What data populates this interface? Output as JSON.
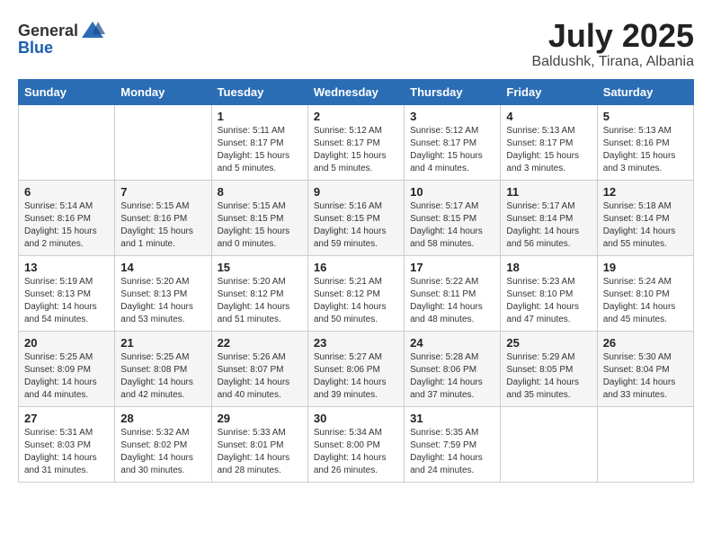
{
  "logo": {
    "text_general": "General",
    "text_blue": "Blue"
  },
  "title": {
    "month_year": "July 2025",
    "location": "Baldushk, Tirana, Albania"
  },
  "headers": [
    "Sunday",
    "Monday",
    "Tuesday",
    "Wednesday",
    "Thursday",
    "Friday",
    "Saturday"
  ],
  "weeks": [
    [
      {
        "day": "",
        "sunrise": "",
        "sunset": "",
        "daylight": ""
      },
      {
        "day": "",
        "sunrise": "",
        "sunset": "",
        "daylight": ""
      },
      {
        "day": "1",
        "sunrise": "Sunrise: 5:11 AM",
        "sunset": "Sunset: 8:17 PM",
        "daylight": "Daylight: 15 hours and 5 minutes."
      },
      {
        "day": "2",
        "sunrise": "Sunrise: 5:12 AM",
        "sunset": "Sunset: 8:17 PM",
        "daylight": "Daylight: 15 hours and 5 minutes."
      },
      {
        "day": "3",
        "sunrise": "Sunrise: 5:12 AM",
        "sunset": "Sunset: 8:17 PM",
        "daylight": "Daylight: 15 hours and 4 minutes."
      },
      {
        "day": "4",
        "sunrise": "Sunrise: 5:13 AM",
        "sunset": "Sunset: 8:17 PM",
        "daylight": "Daylight: 15 hours and 3 minutes."
      },
      {
        "day": "5",
        "sunrise": "Sunrise: 5:13 AM",
        "sunset": "Sunset: 8:16 PM",
        "daylight": "Daylight: 15 hours and 3 minutes."
      }
    ],
    [
      {
        "day": "6",
        "sunrise": "Sunrise: 5:14 AM",
        "sunset": "Sunset: 8:16 PM",
        "daylight": "Daylight: 15 hours and 2 minutes."
      },
      {
        "day": "7",
        "sunrise": "Sunrise: 5:15 AM",
        "sunset": "Sunset: 8:16 PM",
        "daylight": "Daylight: 15 hours and 1 minute."
      },
      {
        "day": "8",
        "sunrise": "Sunrise: 5:15 AM",
        "sunset": "Sunset: 8:15 PM",
        "daylight": "Daylight: 15 hours and 0 minutes."
      },
      {
        "day": "9",
        "sunrise": "Sunrise: 5:16 AM",
        "sunset": "Sunset: 8:15 PM",
        "daylight": "Daylight: 14 hours and 59 minutes."
      },
      {
        "day": "10",
        "sunrise": "Sunrise: 5:17 AM",
        "sunset": "Sunset: 8:15 PM",
        "daylight": "Daylight: 14 hours and 58 minutes."
      },
      {
        "day": "11",
        "sunrise": "Sunrise: 5:17 AM",
        "sunset": "Sunset: 8:14 PM",
        "daylight": "Daylight: 14 hours and 56 minutes."
      },
      {
        "day": "12",
        "sunrise": "Sunrise: 5:18 AM",
        "sunset": "Sunset: 8:14 PM",
        "daylight": "Daylight: 14 hours and 55 minutes."
      }
    ],
    [
      {
        "day": "13",
        "sunrise": "Sunrise: 5:19 AM",
        "sunset": "Sunset: 8:13 PM",
        "daylight": "Daylight: 14 hours and 54 minutes."
      },
      {
        "day": "14",
        "sunrise": "Sunrise: 5:20 AM",
        "sunset": "Sunset: 8:13 PM",
        "daylight": "Daylight: 14 hours and 53 minutes."
      },
      {
        "day": "15",
        "sunrise": "Sunrise: 5:20 AM",
        "sunset": "Sunset: 8:12 PM",
        "daylight": "Daylight: 14 hours and 51 minutes."
      },
      {
        "day": "16",
        "sunrise": "Sunrise: 5:21 AM",
        "sunset": "Sunset: 8:12 PM",
        "daylight": "Daylight: 14 hours and 50 minutes."
      },
      {
        "day": "17",
        "sunrise": "Sunrise: 5:22 AM",
        "sunset": "Sunset: 8:11 PM",
        "daylight": "Daylight: 14 hours and 48 minutes."
      },
      {
        "day": "18",
        "sunrise": "Sunrise: 5:23 AM",
        "sunset": "Sunset: 8:10 PM",
        "daylight": "Daylight: 14 hours and 47 minutes."
      },
      {
        "day": "19",
        "sunrise": "Sunrise: 5:24 AM",
        "sunset": "Sunset: 8:10 PM",
        "daylight": "Daylight: 14 hours and 45 minutes."
      }
    ],
    [
      {
        "day": "20",
        "sunrise": "Sunrise: 5:25 AM",
        "sunset": "Sunset: 8:09 PM",
        "daylight": "Daylight: 14 hours and 44 minutes."
      },
      {
        "day": "21",
        "sunrise": "Sunrise: 5:25 AM",
        "sunset": "Sunset: 8:08 PM",
        "daylight": "Daylight: 14 hours and 42 minutes."
      },
      {
        "day": "22",
        "sunrise": "Sunrise: 5:26 AM",
        "sunset": "Sunset: 8:07 PM",
        "daylight": "Daylight: 14 hours and 40 minutes."
      },
      {
        "day": "23",
        "sunrise": "Sunrise: 5:27 AM",
        "sunset": "Sunset: 8:06 PM",
        "daylight": "Daylight: 14 hours and 39 minutes."
      },
      {
        "day": "24",
        "sunrise": "Sunrise: 5:28 AM",
        "sunset": "Sunset: 8:06 PM",
        "daylight": "Daylight: 14 hours and 37 minutes."
      },
      {
        "day": "25",
        "sunrise": "Sunrise: 5:29 AM",
        "sunset": "Sunset: 8:05 PM",
        "daylight": "Daylight: 14 hours and 35 minutes."
      },
      {
        "day": "26",
        "sunrise": "Sunrise: 5:30 AM",
        "sunset": "Sunset: 8:04 PM",
        "daylight": "Daylight: 14 hours and 33 minutes."
      }
    ],
    [
      {
        "day": "27",
        "sunrise": "Sunrise: 5:31 AM",
        "sunset": "Sunset: 8:03 PM",
        "daylight": "Daylight: 14 hours and 31 minutes."
      },
      {
        "day": "28",
        "sunrise": "Sunrise: 5:32 AM",
        "sunset": "Sunset: 8:02 PM",
        "daylight": "Daylight: 14 hours and 30 minutes."
      },
      {
        "day": "29",
        "sunrise": "Sunrise: 5:33 AM",
        "sunset": "Sunset: 8:01 PM",
        "daylight": "Daylight: 14 hours and 28 minutes."
      },
      {
        "day": "30",
        "sunrise": "Sunrise: 5:34 AM",
        "sunset": "Sunset: 8:00 PM",
        "daylight": "Daylight: 14 hours and 26 minutes."
      },
      {
        "day": "31",
        "sunrise": "Sunrise: 5:35 AM",
        "sunset": "Sunset: 7:59 PM",
        "daylight": "Daylight: 14 hours and 24 minutes."
      },
      {
        "day": "",
        "sunrise": "",
        "sunset": "",
        "daylight": ""
      },
      {
        "day": "",
        "sunrise": "",
        "sunset": "",
        "daylight": ""
      }
    ]
  ]
}
